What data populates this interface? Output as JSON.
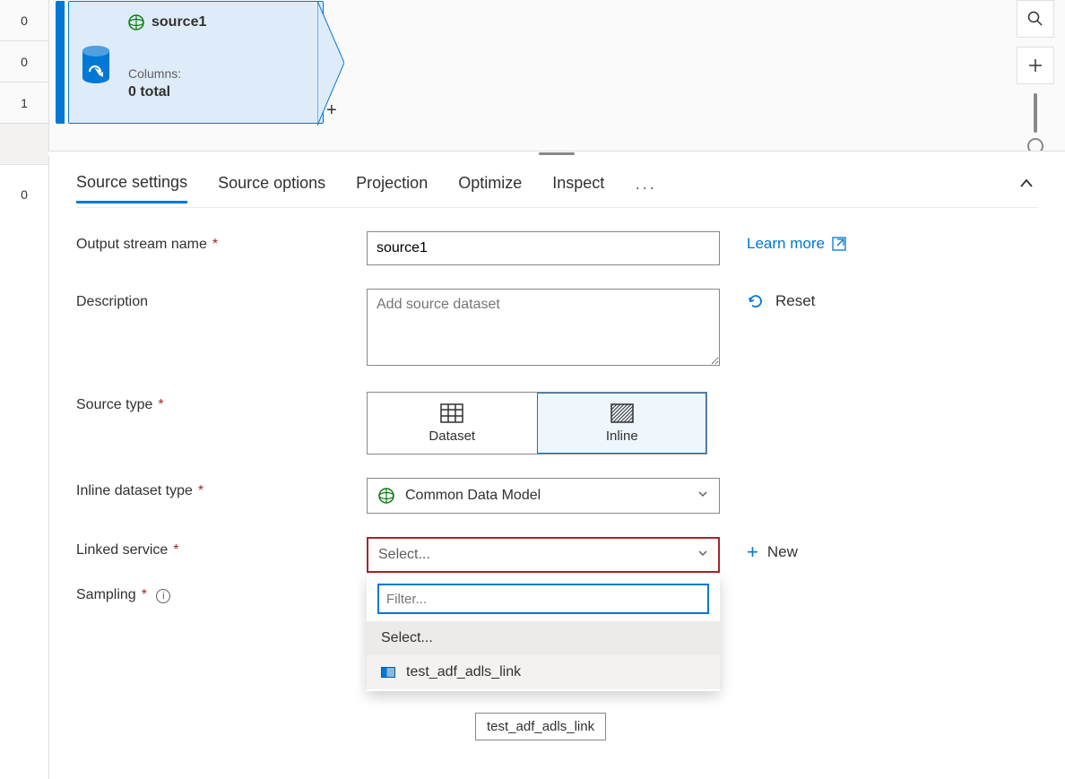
{
  "left_numbers": [
    "0",
    "0",
    "1",
    "",
    "0"
  ],
  "node": {
    "title": "source1",
    "columns_label": "Columns:",
    "total_label": "0 total"
  },
  "tabs": {
    "source_settings": "Source settings",
    "source_options": "Source options",
    "projection": "Projection",
    "optimize": "Optimize",
    "inspect": "Inspect",
    "more": "···"
  },
  "form": {
    "output_stream_label": "Output stream name",
    "output_stream_value": "source1",
    "description_label": "Description",
    "description_placeholder": "Add source dataset",
    "source_type_label": "Source type",
    "source_type_options": {
      "dataset": "Dataset",
      "inline": "Inline"
    },
    "inline_dataset_label": "Inline dataset type",
    "inline_dataset_value": "Common Data Model",
    "linked_service_label": "Linked service",
    "linked_service_placeholder": "Select...",
    "sampling_label": "Sampling"
  },
  "actions": {
    "learn_more": "Learn more",
    "reset": "Reset",
    "new": "New"
  },
  "dropdown": {
    "filter_placeholder": "Filter...",
    "select_option": "Select...",
    "item1": "test_adf_adls_link"
  },
  "tooltip": "test_adf_adls_link"
}
